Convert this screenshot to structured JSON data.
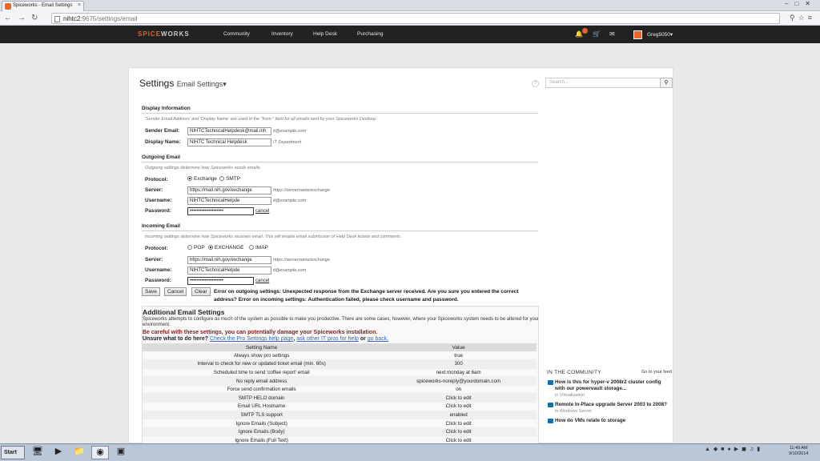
{
  "browser": {
    "tab_title": "Spiceworks - Email Settings",
    "url_host": "nihtc2",
    "url_path": ":9675/settings/email"
  },
  "topnav": {
    "logo_a": "SPICE",
    "logo_b": "WORKS",
    "items": [
      "Community",
      "Inventory",
      "Help Desk",
      "Purchasing"
    ],
    "notif_count": "",
    "user": "Greg5050▾"
  },
  "page": {
    "title": "Settings",
    "subtitle": "Email Settings▾",
    "search_placeholder": "Search..."
  },
  "display": {
    "heading": "Display Information",
    "note": "'Sender Email Address' and 'Display Name' are used in the \"from:\" field for all emails sent by your Spiceworks Desktop.",
    "sender_label": "Sender Email:",
    "sender_value": "NIHTCTechnicalHelpdesk@mail.nih",
    "sender_hint": "it@example.com",
    "name_label": "Display Name:",
    "name_value": "NIHTC Technical Helpdesk",
    "name_hint": "IT Department"
  },
  "outgoing": {
    "heading": "Outgoing Email",
    "note": "Outgoing settings determine how Spiceworks sends emails.",
    "protocol_label": "Protocol:",
    "opt1": "Exchange",
    "opt2": "SMTP",
    "server_label": "Server:",
    "server_value": "https://mail.nih.gov/exchange",
    "server_hint": "https://servername/exchange",
    "user_label": "Username:",
    "user_value": "NIHTCTechnicalHelpde",
    "user_hint": "it@example.com",
    "pass_label": "Password:",
    "pass_value": "••••••••••••••••••••",
    "cancel": "cancel"
  },
  "incoming": {
    "heading": "Incoming Email",
    "note": "Incoming settings determine how Spiceworks receives email. This will enable email submission of Help Desk tickets and comments.",
    "protocol_label": "Protocol:",
    "opt1": "POP",
    "opt2": "EXCHANGE",
    "opt3": "IMAP",
    "server_label": "Server:",
    "server_value": "https://mail.nih.gov/exchange",
    "server_hint": "https://servername/exchange",
    "user_label": "Username:",
    "user_value": "NIHTCTechnicalHelpde",
    "user_hint": "it@example.com",
    "pass_label": "Password:",
    "pass_value": "••••••••••••••••••••",
    "cancel": "cancel"
  },
  "actions": {
    "save": "Save",
    "cancel": "Cancel",
    "clear": "Clear",
    "error": "Error on outgoing settings: Unexpected response from the Exchange server received. Are you sure you entered the correct address? Error on incoming settings: Authentication failed, please check username and password."
  },
  "additional": {
    "heading": "Additional Email Settings",
    "desc": "Spiceworks attempts to configure as much of the system as possible to make you productive. There are some cases, however, where your Spiceworks system needs to be altered for your environment.",
    "warn": "Be careful with these settings, you can potentially damage your Spiceworks installation.",
    "unsure": "Unsure what to do here?",
    "link1": "Check the Pro Settings help page",
    "sep": ", ",
    "link2": "ask other IT pros for help",
    "or": " or ",
    "link3": "go back.",
    "col1": "Setting Name",
    "col2": "Value",
    "rows": [
      [
        "Always show pro settings",
        "true"
      ],
      [
        "Interval to check for new or updated ticket email (min. 60s)",
        "300"
      ],
      [
        "Scheduled time to send 'coffee report' email",
        "next monday at 6am"
      ],
      [
        "No reply email address",
        "spiceworks-noreply@yourdomain.com"
      ],
      [
        "Force send confirmation emails",
        "on"
      ],
      [
        "SMTP HELO domain",
        "Click to edit"
      ],
      [
        "Email URL Hostname",
        "Click to edit"
      ],
      [
        "SMTP TLS support",
        "enabled"
      ],
      [
        "Ignore Emails (Subject)",
        "Click to edit"
      ],
      [
        "Ignore Emails (Body)",
        "Click to edit"
      ],
      [
        "Ignore Emails (Full Text)",
        "Click to edit"
      ]
    ]
  },
  "community": {
    "heading": "IN THE COMMUNITY",
    "feed": "Go to your feed",
    "posts": [
      {
        "title": "How is this for hyper-v 2008r2 cluster config with our powervault storage...",
        "cat": "in Virtualization"
      },
      {
        "title": "Remote In-Place upgrade Server 2003 to 2008?",
        "cat": "in Windows Server"
      },
      {
        "title": "How do VMs relate to storage",
        "cat": ""
      }
    ]
  },
  "taskbar": {
    "start": "Start",
    "time": "11:49 AM",
    "date": "9/10/2014"
  }
}
